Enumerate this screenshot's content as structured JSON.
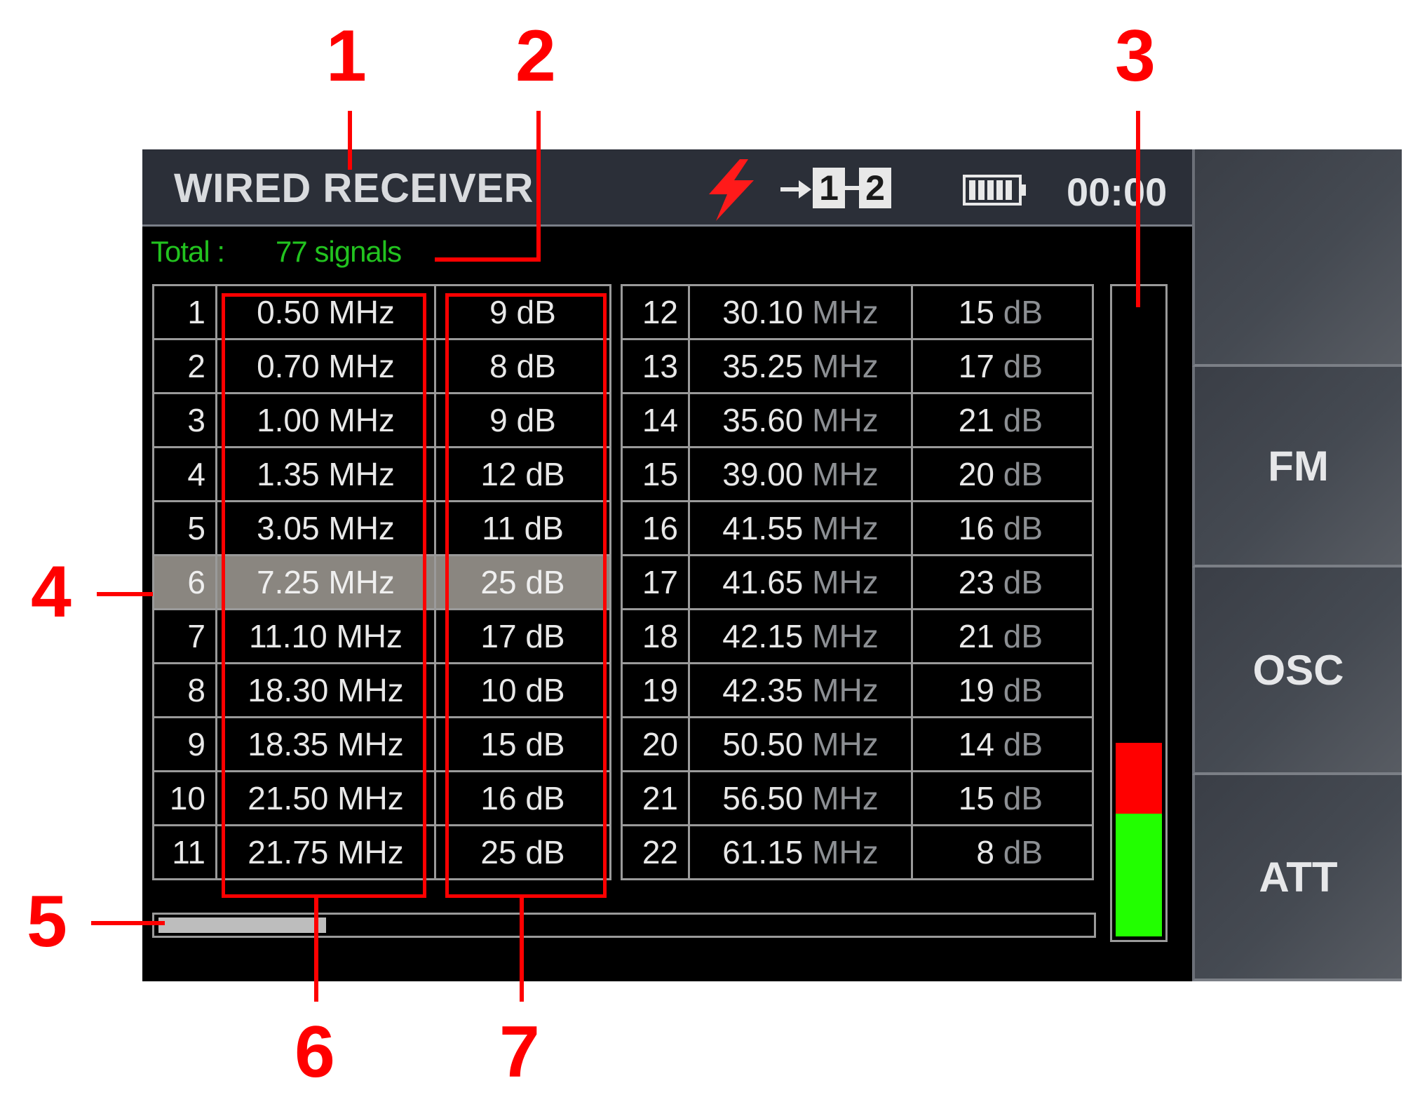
{
  "header": {
    "title": "WIRED RECEIVER",
    "clock": "00:00",
    "channel_from": "1",
    "channel_to": "2",
    "icons": [
      "lightning-icon",
      "arrow-right-icon",
      "battery-icon"
    ]
  },
  "summary": {
    "total_label": "Total :",
    "total_value": "77 signals"
  },
  "colors": {
    "accent_green": "#22c31f",
    "meter_green": "#22ff00",
    "meter_red": "#ff0000",
    "lightning": "#ff1a1a",
    "annotation": "#ff0000"
  },
  "signals_left": [
    {
      "index": "1",
      "freq": "0.50",
      "freq_unit": "MHz",
      "level": "9",
      "level_unit": "dB"
    },
    {
      "index": "2",
      "freq": "0.70",
      "freq_unit": "MHz",
      "level": "8",
      "level_unit": "dB"
    },
    {
      "index": "3",
      "freq": "1.00",
      "freq_unit": "MHz",
      "level": "9",
      "level_unit": "dB"
    },
    {
      "index": "4",
      "freq": "1.35",
      "freq_unit": "MHz",
      "level": "12",
      "level_unit": "dB"
    },
    {
      "index": "5",
      "freq": "3.05",
      "freq_unit": "MHz",
      "level": "11",
      "level_unit": "dB"
    },
    {
      "index": "6",
      "freq": "7.25",
      "freq_unit": "MHz",
      "level": "25",
      "level_unit": "dB",
      "selected": true
    },
    {
      "index": "7",
      "freq": "11.10",
      "freq_unit": "MHz",
      "level": "17",
      "level_unit": "dB"
    },
    {
      "index": "8",
      "freq": "18.30",
      "freq_unit": "MHz",
      "level": "10",
      "level_unit": "dB"
    },
    {
      "index": "9",
      "freq": "18.35",
      "freq_unit": "MHz",
      "level": "15",
      "level_unit": "dB"
    },
    {
      "index": "10",
      "freq": "21.50",
      "freq_unit": "MHz",
      "level": "16",
      "level_unit": "dB"
    },
    {
      "index": "11",
      "freq": "21.75",
      "freq_unit": "MHz",
      "level": "25",
      "level_unit": "dB"
    }
  ],
  "signals_right": [
    {
      "index": "12",
      "freq": "30.10",
      "freq_unit": "MHz",
      "level": "15",
      "level_unit": "dB"
    },
    {
      "index": "13",
      "freq": "35.25",
      "freq_unit": "MHz",
      "level": "17",
      "level_unit": "dB"
    },
    {
      "index": "14",
      "freq": "35.60",
      "freq_unit": "MHz",
      "level": "21",
      "level_unit": "dB"
    },
    {
      "index": "15",
      "freq": "39.00",
      "freq_unit": "MHz",
      "level": "20",
      "level_unit": "dB"
    },
    {
      "index": "16",
      "freq": "41.55",
      "freq_unit": "MHz",
      "level": "16",
      "level_unit": "dB"
    },
    {
      "index": "17",
      "freq": "41.65",
      "freq_unit": "MHz",
      "level": "23",
      "level_unit": "dB"
    },
    {
      "index": "18",
      "freq": "42.15",
      "freq_unit": "MHz",
      "level": "21",
      "level_unit": "dB"
    },
    {
      "index": "19",
      "freq": "42.35",
      "freq_unit": "MHz",
      "level": "19",
      "level_unit": "dB"
    },
    {
      "index": "20",
      "freq": "50.50",
      "freq_unit": "MHz",
      "level": "14",
      "level_unit": "dB"
    },
    {
      "index": "21",
      "freq": "56.50",
      "freq_unit": "MHz",
      "level": "15",
      "level_unit": "dB"
    },
    {
      "index": "22",
      "freq": "61.15",
      "freq_unit": "MHz",
      "level": "8",
      "level_unit": "dB"
    }
  ],
  "scrollbar": {
    "position_fraction": 0.18
  },
  "level_meter": {
    "green_fraction": 0.19,
    "red_fraction": 0.11
  },
  "softkeys": [
    {
      "label": ""
    },
    {
      "label": "FM"
    },
    {
      "label": "OSC"
    },
    {
      "label": "ATT"
    }
  ],
  "annotations": {
    "title": "1",
    "total": "2",
    "meter": "3",
    "selected_row": "4",
    "scrollbar": "5",
    "frequency_column": "6",
    "level_column": "7"
  }
}
